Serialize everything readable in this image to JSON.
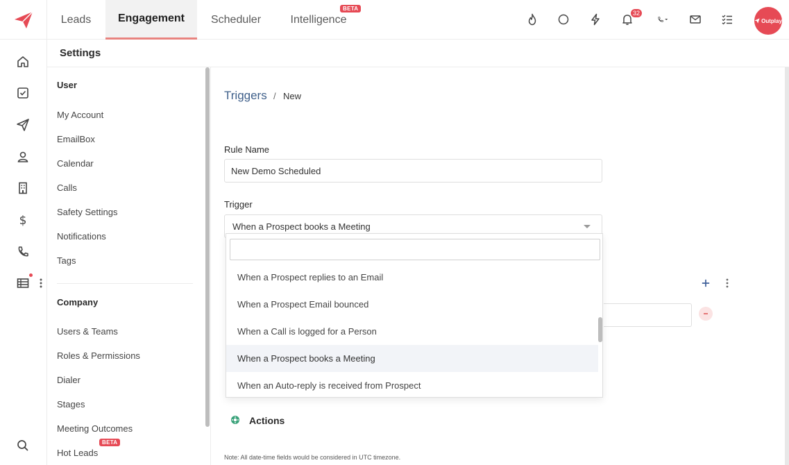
{
  "top_nav": {
    "tabs": [
      {
        "label": "Leads"
      },
      {
        "label": "Engagement"
      },
      {
        "label": "Scheduler"
      },
      {
        "label": "Intelligence",
        "badge": "BETA"
      }
    ],
    "notification_count": "32",
    "avatar_text": "Outplay"
  },
  "settings": {
    "title": "Settings",
    "user_section": {
      "heading": "User",
      "items": [
        "My Account",
        "EmailBox",
        "Calendar",
        "Calls",
        "Safety Settings",
        "Notifications",
        "Tags"
      ]
    },
    "company_section": {
      "heading": "Company",
      "items": [
        "Users & Teams",
        "Roles & Permissions",
        "Dialer",
        "Stages",
        "Meeting Outcomes",
        "Hot Leads"
      ],
      "hot_leads_badge": "BETA"
    }
  },
  "breadcrumb": {
    "parent": "Triggers",
    "separator": "/",
    "current": "New"
  },
  "form": {
    "rule_name_label": "Rule Name",
    "rule_name_value": "New Demo Scheduled",
    "trigger_label": "Trigger",
    "trigger_value": "When a Prospect books a Meeting",
    "trigger_options": [
      "When a Prospect replies to an Email",
      "When a Prospect Email bounced",
      "When a Call is logged for a Person",
      "When a Prospect books a Meeting",
      "When an Auto-reply is received from Prospect"
    ],
    "selected_option_index": 3,
    "actions_label": "Actions",
    "note": "Note: All date-time fields would be considered in UTC timezone."
  },
  "colors": {
    "accent_red": "#e64a55",
    "link_blue": "#3e5f8a",
    "actions_green": "#3aa27a"
  }
}
